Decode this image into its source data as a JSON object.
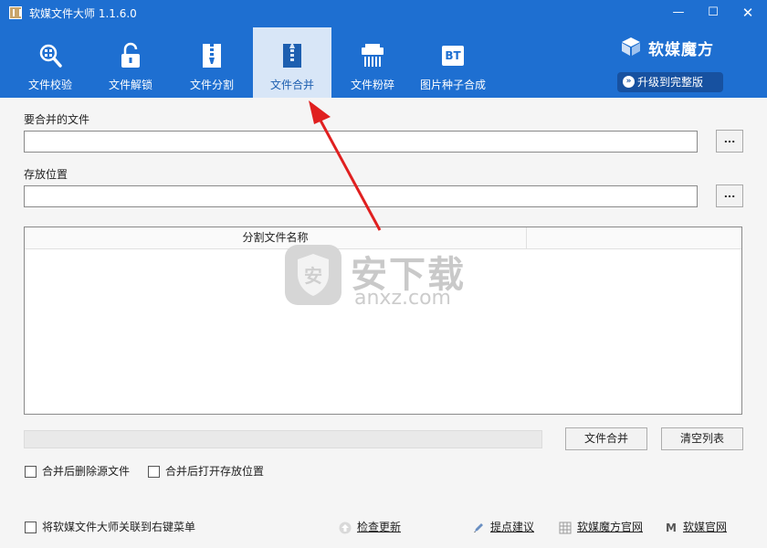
{
  "app": {
    "title": "软媒文件大师 1.1.6.0",
    "minimize": "—",
    "maximize": "☐",
    "close": "✕"
  },
  "toolbar": {
    "items": [
      {
        "label": "文件校验",
        "icon": "magnifier-grid-icon"
      },
      {
        "label": "文件解锁",
        "icon": "unlock-icon"
      },
      {
        "label": "文件分割",
        "icon": "zipper-split-icon"
      },
      {
        "label": "文件合并",
        "icon": "zipper-merge-icon",
        "active": true
      },
      {
        "label": "文件粉碎",
        "icon": "shredder-icon"
      },
      {
        "label": "图片种子合成",
        "icon": "bt-icon",
        "icon_text": "BT"
      }
    ]
  },
  "brand": {
    "name": "软媒魔方",
    "upgrade_label": "升级到完整版",
    "upgrade_icon": "»"
  },
  "form": {
    "merge_file_label": "要合并的文件",
    "merge_file_value": "",
    "save_location_label": "存放位置",
    "save_location_value": "",
    "browse_label": "..."
  },
  "list": {
    "column_header": "分割文件名称",
    "rows": []
  },
  "progress": {
    "value": 0
  },
  "actions": {
    "merge_label": "文件合并",
    "clear_label": "清空列表"
  },
  "options": {
    "delete_source": {
      "label": "合并后删除源文件",
      "checked": false
    },
    "open_location": {
      "label": "合并后打开存放位置",
      "checked": false
    },
    "context_menu": {
      "label": "将软媒文件大师关联到右键菜单",
      "checked": false
    }
  },
  "footer": {
    "check_update": "检查更新",
    "suggestion": "提点建议",
    "mofang_site": "软媒魔方官网",
    "ruanmei_site": "软媒官网",
    "ruanmei_icon_text": "M"
  },
  "watermark": {
    "text": "安下载",
    "sub": "anxz.com"
  },
  "colors": {
    "header_blue": "#1e6fd1",
    "active_tab": "#d8e6f7",
    "upgrade_bg": "#1751a0",
    "arrow_red": "#e02020"
  }
}
